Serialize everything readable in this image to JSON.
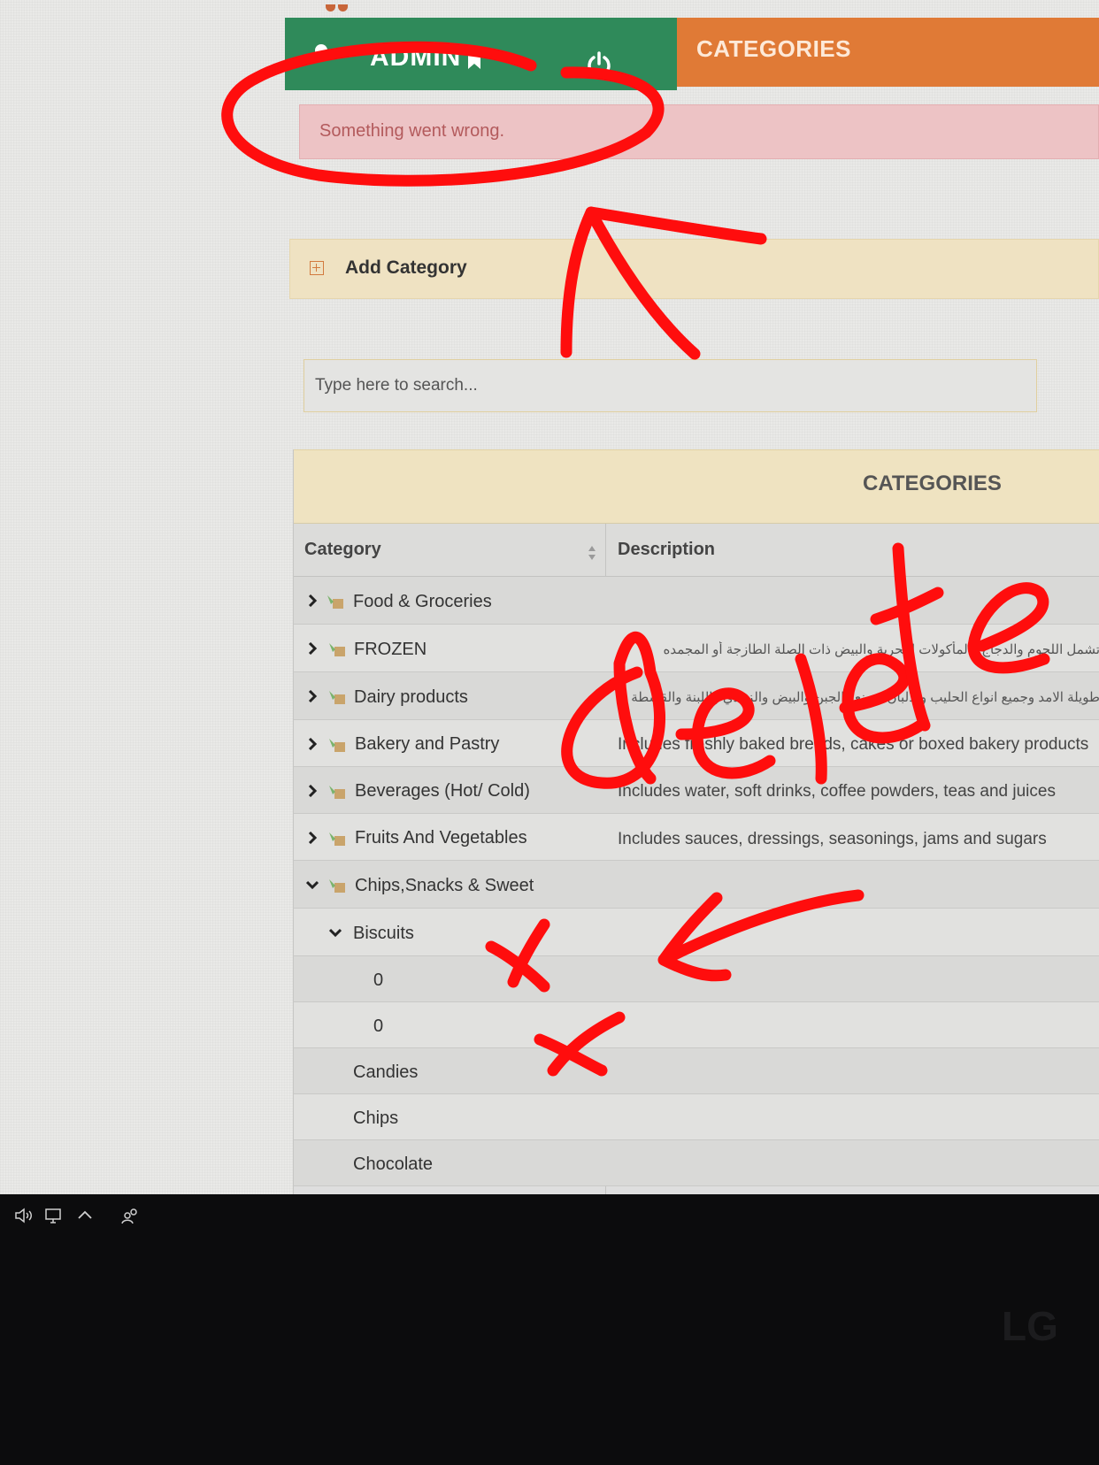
{
  "header": {
    "admin_label": "ADMIN",
    "section_title": "CATEGORIES",
    "admin_color": "#2f8a5a",
    "section_color": "#e07a36"
  },
  "alert": {
    "message": "Something went wrong.",
    "type": "error"
  },
  "add_category": {
    "label": "Add Category"
  },
  "search": {
    "placeholder": "Type here to search..."
  },
  "table": {
    "title": "CATEGORIES",
    "columns": [
      "Category",
      "Description"
    ],
    "rows": [
      {
        "label": "Food & Groceries",
        "description": "",
        "expanded": false
      },
      {
        "label": "FROZEN",
        "description": "تشمل اللحوم والدجاج والمأكولات البحرية والبيض ذات الصلة الطازجة أو المجمده",
        "expanded": false
      },
      {
        "label": "Dairy products",
        "description": "طويلة الامد وجميع انواع الحليب والالبان وصنع والجبن والبيض والزبادي واللبنة والقشطة",
        "expanded": false
      },
      {
        "label": "Bakery and Pastry",
        "description": "Includes freshly baked breads, cakes or boxed bakery products",
        "expanded": false
      },
      {
        "label": "Beverages (Hot/ Cold)",
        "description": "Includes water, soft drinks, coffee powders, teas and juices",
        "expanded": false
      },
      {
        "label": "Fruits And Vegetables",
        "description": "Includes sauces, dressings, seasonings, jams and sugars",
        "expanded": false
      },
      {
        "label": "Chips,Snacks & Sweet",
        "description": "",
        "expanded": true
      },
      {
        "label": "Biscuits",
        "description": "",
        "expanded": true
      },
      {
        "label": "0",
        "description": ""
      },
      {
        "label": "0",
        "description": ""
      },
      {
        "label": "Candies",
        "description": ""
      },
      {
        "label": "Chips",
        "description": ""
      },
      {
        "label": "Chocolate",
        "description": ""
      }
    ]
  },
  "annotations": {
    "handwritten_text": "delete",
    "marks": [
      "x",
      "x"
    ],
    "color": "#ff0000"
  },
  "taskbar": {
    "icons": [
      "speaker-icon",
      "network-icon",
      "chevron-up-icon",
      "people-icon"
    ]
  },
  "monitor_brand": "LG"
}
